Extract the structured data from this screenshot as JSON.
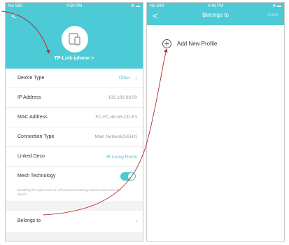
{
  "left": {
    "status": {
      "carrier": "No SIM",
      "time": "4:59 PM",
      "icons": "⊕ ▬"
    },
    "back_glyph": "<",
    "device_name": "TP-Link-iphone >",
    "rows": [
      {
        "label": "Device Type",
        "value": "Other"
      },
      {
        "label": "IP Address",
        "value": "192.168.68.50"
      },
      {
        "label": "MAC Address",
        "value": "FC-FC-48-95-CD-F3"
      },
      {
        "label": "Connection Type",
        "value": "Main Network(5GHz)"
      },
      {
        "label": "Linked Deco",
        "value": "Living Room"
      },
      {
        "label": "Mesh Technology",
        "value": ""
      }
    ],
    "mesh_note": "Disabling this option will turn off seamless roaming between Decos for this device.",
    "belongs_label": "Belongs to"
  },
  "right": {
    "status": {
      "carrier": "No SIM",
      "time": "4:48 PM",
      "icons": "⊕ ▬"
    },
    "back_glyph": "<",
    "title": "Belongs to",
    "save_label": "Save",
    "add_profile_label": "Add New Profile"
  },
  "colors": {
    "accent": "#4ccad6",
    "arrow": "#b02a2a"
  }
}
